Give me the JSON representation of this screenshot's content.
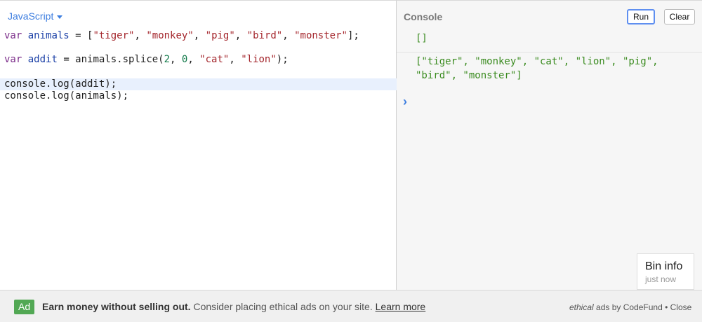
{
  "editor": {
    "language": "JavaScript",
    "lines": [
      {
        "kw": "var",
        "def": "animals",
        "op": " = [",
        "s1": "\"tiger\"",
        "c1": ", ",
        "s2": "\"monkey\"",
        "c2": ", ",
        "s3": "\"pig\"",
        "c3": ", ",
        "s4": "\"bird\"",
        "c4": ", ",
        "s5": "\"monster\"",
        "end": "];"
      },
      {
        "kw": "var",
        "def": "addit",
        "op": " = animals.splice(",
        "n1": "2",
        "c1": ", ",
        "n2": "0",
        "c2": ", ",
        "s1": "\"cat\"",
        "c3": ", ",
        "s2": "\"lion\"",
        "end": ");"
      },
      {
        "text": "console.log(addit);"
      },
      {
        "text": "console.log(animals);"
      }
    ]
  },
  "console": {
    "title": "Console",
    "run_label": "Run",
    "clear_label": "Clear",
    "output": [
      "[]",
      "[\"tiger\", \"monkey\", \"cat\", \"lion\", \"pig\",\n\"bird\", \"monster\"]"
    ],
    "prompt": "›",
    "bin_info_title": "Bin info",
    "bin_info_sub": "just now"
  },
  "ad": {
    "badge": "Ad",
    "headline": "Earn money without selling out.",
    "body": " Consider placing ethical ads on your site. ",
    "link": "Learn more",
    "ethical": "ethical",
    "ads_by": " ads by CodeFund",
    "separator": " • ",
    "close": "Close"
  },
  "colors": {
    "accent": "#3d7ee0",
    "console_output": "#3a8b1f",
    "ad_badge": "#52a854"
  },
  "icons": {
    "language_dropdown": "caret-down-icon",
    "console_prompt": "chevron-right-icon"
  }
}
